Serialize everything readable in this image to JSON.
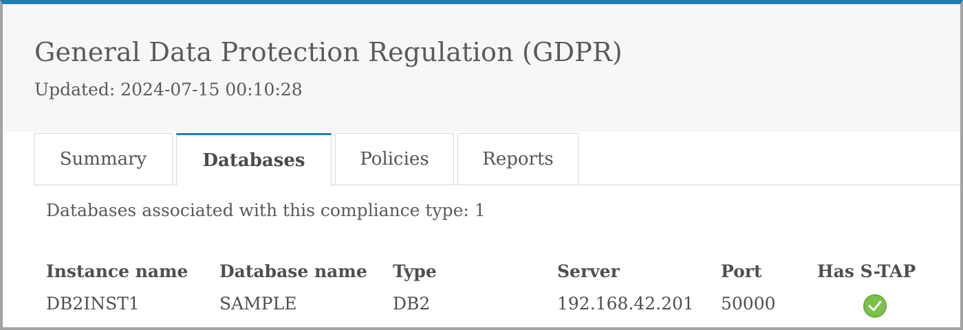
{
  "header": {
    "title": "General Data Protection Regulation (GDPR)",
    "updated_label": "Updated:",
    "updated_value": "2024-07-15 00:10:28"
  },
  "tabs": [
    {
      "label": "Summary",
      "active": false
    },
    {
      "label": "Databases",
      "active": true
    },
    {
      "label": "Policies",
      "active": false
    },
    {
      "label": "Reports",
      "active": false
    }
  ],
  "databases": {
    "count_text": "Databases associated with this compliance type: 1",
    "columns": [
      "Instance name",
      "Database name",
      "Type",
      "Server",
      "Port",
      "Has S-TAP"
    ],
    "rows": [
      {
        "instance": "DB2INST1",
        "database": "SAMPLE",
        "type": "DB2",
        "server": "192.168.42.201",
        "port": "50000",
        "has_stap": "check-circle-icon"
      }
    ]
  },
  "colors": {
    "accent": "#1f7fb2",
    "success": "#7cc24a"
  }
}
